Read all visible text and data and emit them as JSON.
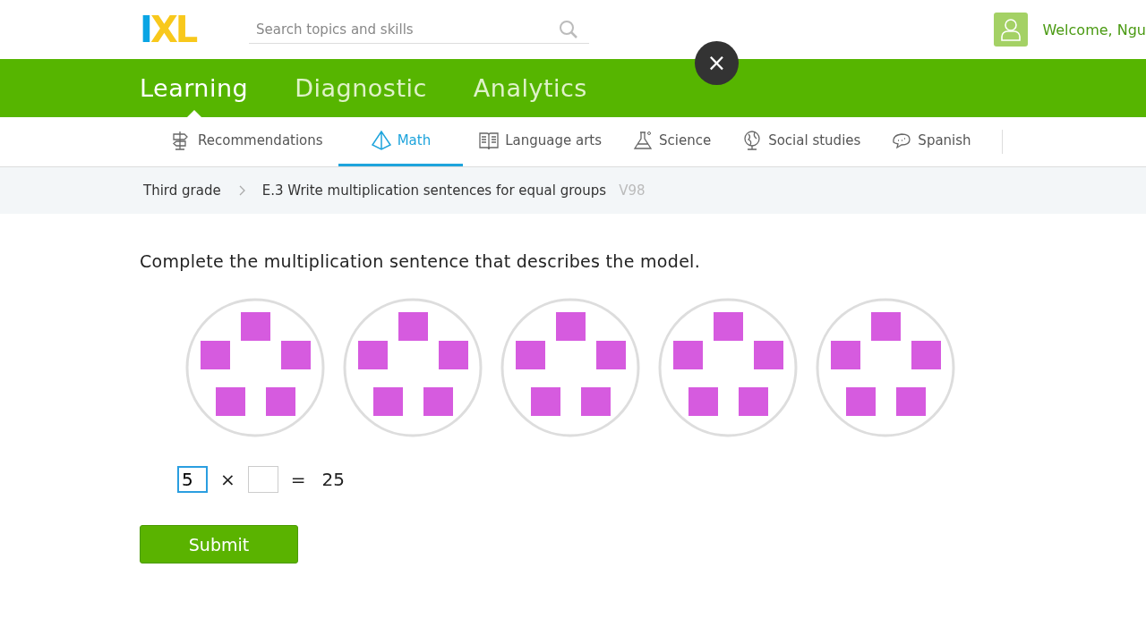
{
  "header": {
    "logo": "IXL",
    "search": {
      "placeholder": "Search topics and skills"
    },
    "welcome": "Welcome, Ngu"
  },
  "close_button": "×",
  "main_tabs": [
    {
      "label": "Learning",
      "selected": true
    },
    {
      "label": "Diagnostic",
      "selected": false
    },
    {
      "label": "Analytics",
      "selected": false
    }
  ],
  "subjects": [
    {
      "label": "Recommendations",
      "kind": "signpost",
      "selected": false
    },
    {
      "label": "Math",
      "kind": "pyramid",
      "selected": true
    },
    {
      "label": "Language arts",
      "kind": "book",
      "selected": false
    },
    {
      "label": "Science",
      "kind": "flask",
      "selected": false
    },
    {
      "label": "Social studies",
      "kind": "globe",
      "selected": false
    },
    {
      "label": "Spanish",
      "kind": "speech",
      "selected": false
    }
  ],
  "breadcrumb": {
    "grade": "Third grade",
    "skill": "E.3 Write multiplication sentences for equal groups",
    "code": "V98"
  },
  "question": {
    "prompt": "Complete the multiplication sentence that describes the model.",
    "groups": [
      {
        "kind": "five"
      },
      {
        "kind": "five"
      },
      {
        "kind": "five"
      },
      {
        "kind": "five"
      },
      {
        "kind": "five"
      }
    ],
    "equation": [
      {
        "kind": "input",
        "value": "5",
        "focused": true
      },
      {
        "kind": "symbol",
        "text": "×"
      },
      {
        "kind": "input",
        "focused": false
      },
      {
        "kind": "symbol",
        "text": "="
      },
      {
        "kind": "symbol",
        "text": "25"
      }
    ],
    "submit": "Submit"
  }
}
